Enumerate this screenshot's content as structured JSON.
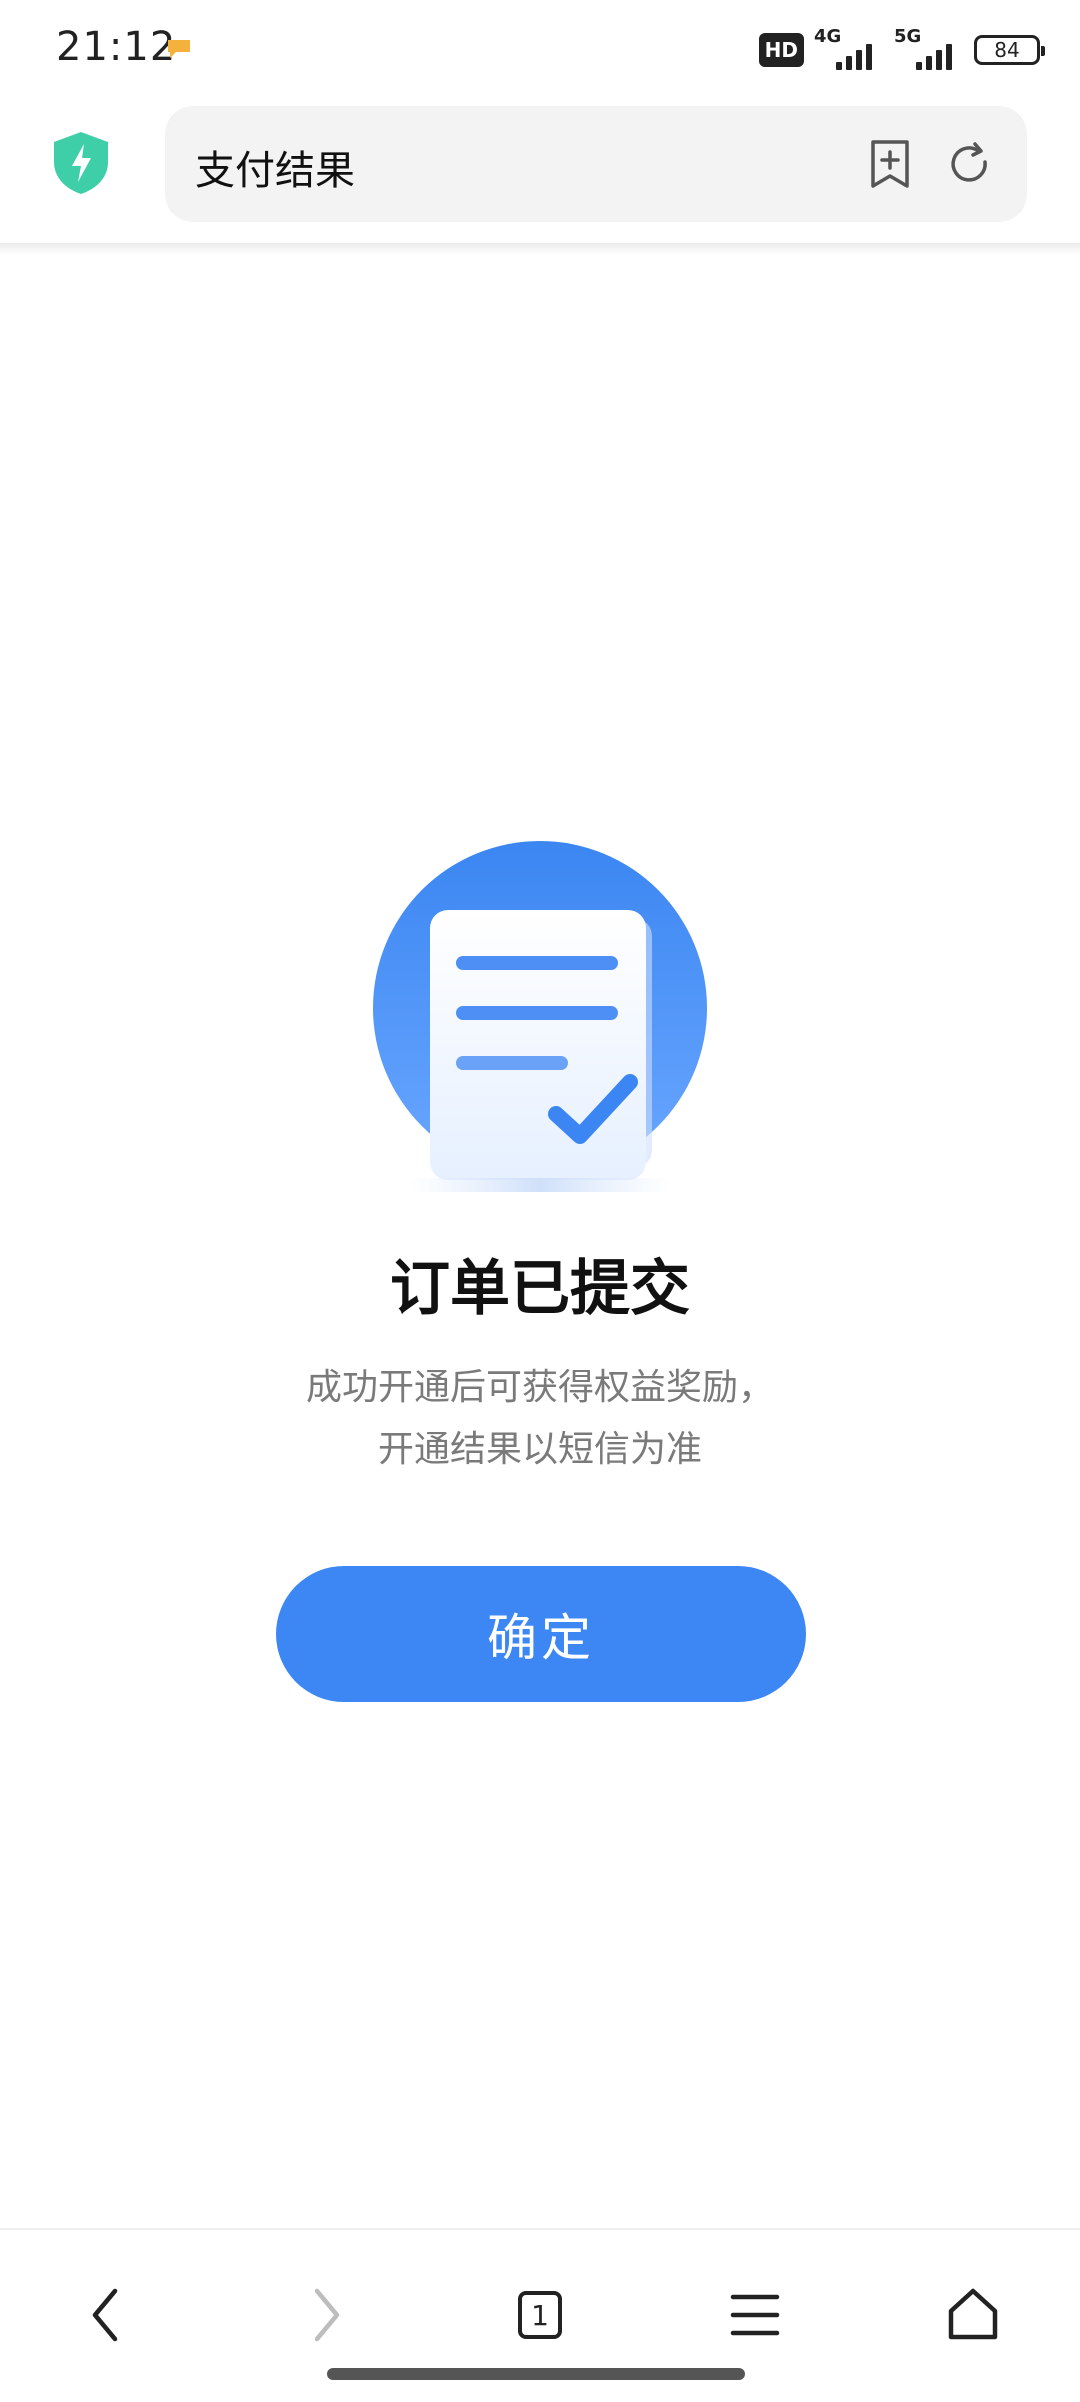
{
  "status_bar": {
    "time": "21:12",
    "hd_label": "HD",
    "network1": "4G",
    "network2": "5G",
    "battery": "84"
  },
  "browser": {
    "page_title": "支付结果",
    "security_icon": "shield-bolt-icon",
    "bookmark_icon": "bookmark-add-icon",
    "reload_icon": "reload-icon"
  },
  "result": {
    "title": "订单已提交",
    "desc_line1": "成功开通后可获得权益奖励，",
    "desc_line2": "开通结果以短信为准",
    "confirm_label": "确定"
  },
  "bottom_nav": {
    "back_icon": "back-icon",
    "forward_icon": "forward-icon",
    "tab_count": "1",
    "menu_icon": "menu-icon",
    "home_icon": "home-icon"
  },
  "colors": {
    "accent": "#3d87f5",
    "shield": "#3fcfa8"
  }
}
